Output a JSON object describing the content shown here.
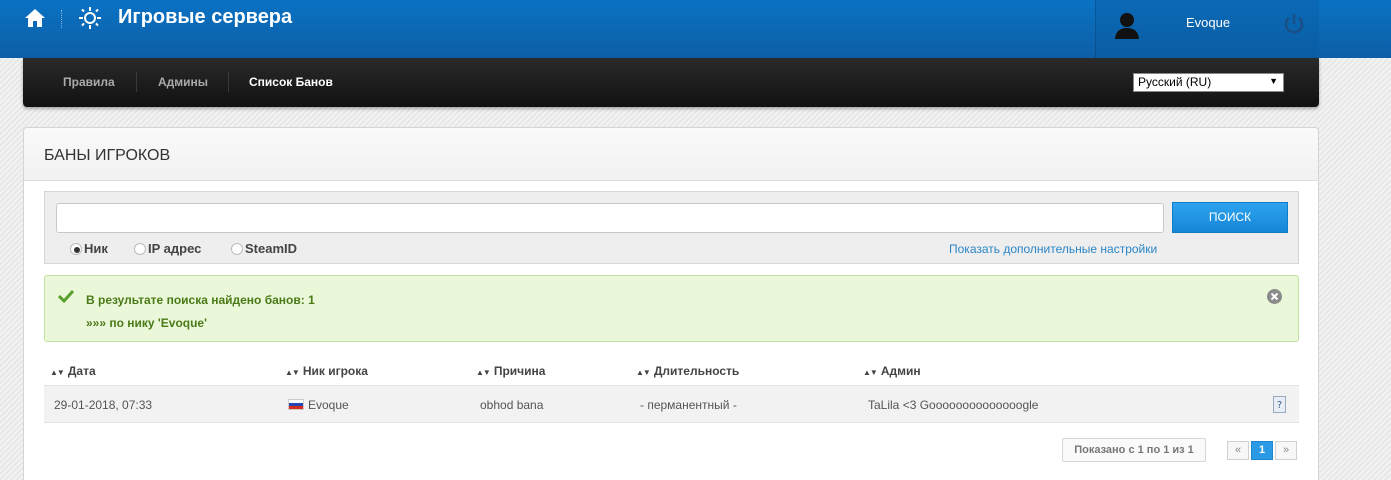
{
  "header": {
    "title": "Игровые сервера",
    "username": "Evoque"
  },
  "nav": {
    "items": [
      {
        "label": "Правила"
      },
      {
        "label": "Админы"
      },
      {
        "label": "Список Банов"
      }
    ],
    "language": "Русский (RU)"
  },
  "panel": {
    "title": "БАНЫ ИГРОКОВ",
    "search": {
      "value": "",
      "button": "ПОИСК",
      "options": [
        "Ник",
        "IP адрес",
        "SteamID"
      ],
      "selected": "Ник",
      "advanced_link": "Показать дополнительные настройки"
    },
    "alert": {
      "line1": "В результате поиска найдено банов: 1",
      "line2": "»»» по нику 'Evoque'"
    },
    "table": {
      "headers": [
        "Дата",
        "Ник игрока",
        "Причина",
        "Длительность",
        "Админ"
      ],
      "rows": [
        {
          "date": "29-01-2018, 07:33",
          "nick": "Evoque",
          "reason": "obhod bana",
          "duration": "- перманентный -",
          "admin": "TaLila <3 Goooooooooooooogle"
        }
      ]
    },
    "pagination": {
      "info": "Показано с 1 по 1 из 1",
      "prev": "«",
      "current": "1",
      "next": "»"
    }
  },
  "colors": {
    "header_blue": "#0a72c4",
    "accent_blue": "#2b9ae4",
    "success_green": "#4a7a18"
  }
}
